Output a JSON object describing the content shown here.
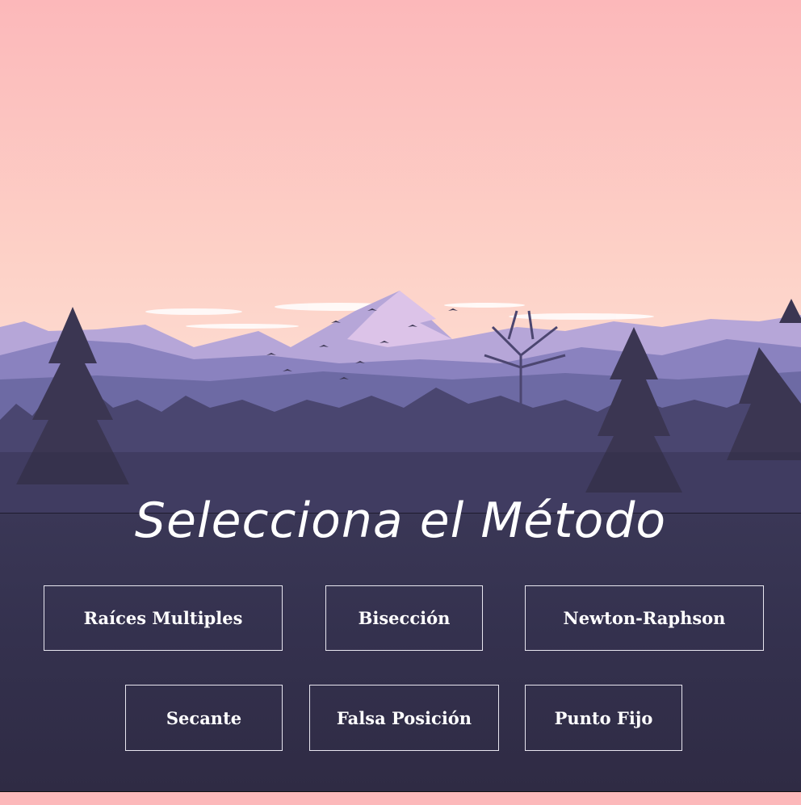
{
  "page": {
    "title": "Selecciona el Método"
  },
  "methods": [
    {
      "label": "Raíces Multiples"
    },
    {
      "label": "Bisección"
    },
    {
      "label": "Newton-Raphson"
    },
    {
      "label": "Secante"
    },
    {
      "label": "Falsa Posición"
    },
    {
      "label": "Punto Fijo"
    }
  ],
  "colors": {
    "sky_top": "#fcb8ba",
    "sky_horizon": "#fde0d8",
    "panel": "#36334f",
    "button_border": "#e8e6f0",
    "text": "#ffffff"
  }
}
